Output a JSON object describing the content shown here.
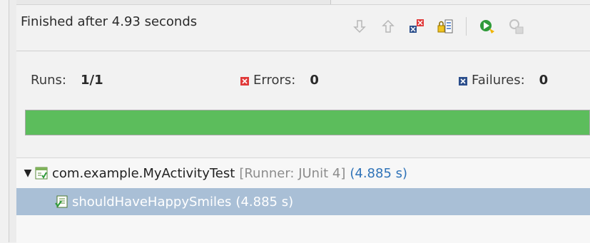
{
  "status": {
    "text": "Finished after 4.93 seconds"
  },
  "toolbar": {
    "buttons": [
      {
        "name": "next-failure-icon",
        "enabled": false
      },
      {
        "name": "previous-failure-icon",
        "enabled": false
      },
      {
        "name": "show-failures-only-icon",
        "enabled": true
      },
      {
        "name": "scroll-lock-icon",
        "enabled": true
      },
      {
        "name": "rerun-test-icon",
        "enabled": true
      },
      {
        "name": "rerun-failed-first-icon",
        "enabled": false
      }
    ]
  },
  "counters": {
    "runs_label": "Runs:",
    "runs_value": "1/1",
    "errors_label": "Errors:",
    "errors_value": "0",
    "failures_label": "Failures:",
    "failures_value": "0"
  },
  "progress": {
    "fraction": 1.0,
    "color": "#5cbd5c"
  },
  "tree": {
    "suite": {
      "name": "com.example.MyActivityTest",
      "runner": "[Runner: JUnit 4]",
      "time": "(4.885 s)"
    },
    "tests": [
      {
        "name": "shouldHaveHappySmiles",
        "time": "(4.885 s)"
      }
    ]
  },
  "colors": {
    "success": "#5cbd5c",
    "selection": "#a9bfd6",
    "error_badge": "#e03a3a",
    "failure_badge": "#2c4f8c",
    "time_text": "#2f73b8"
  }
}
